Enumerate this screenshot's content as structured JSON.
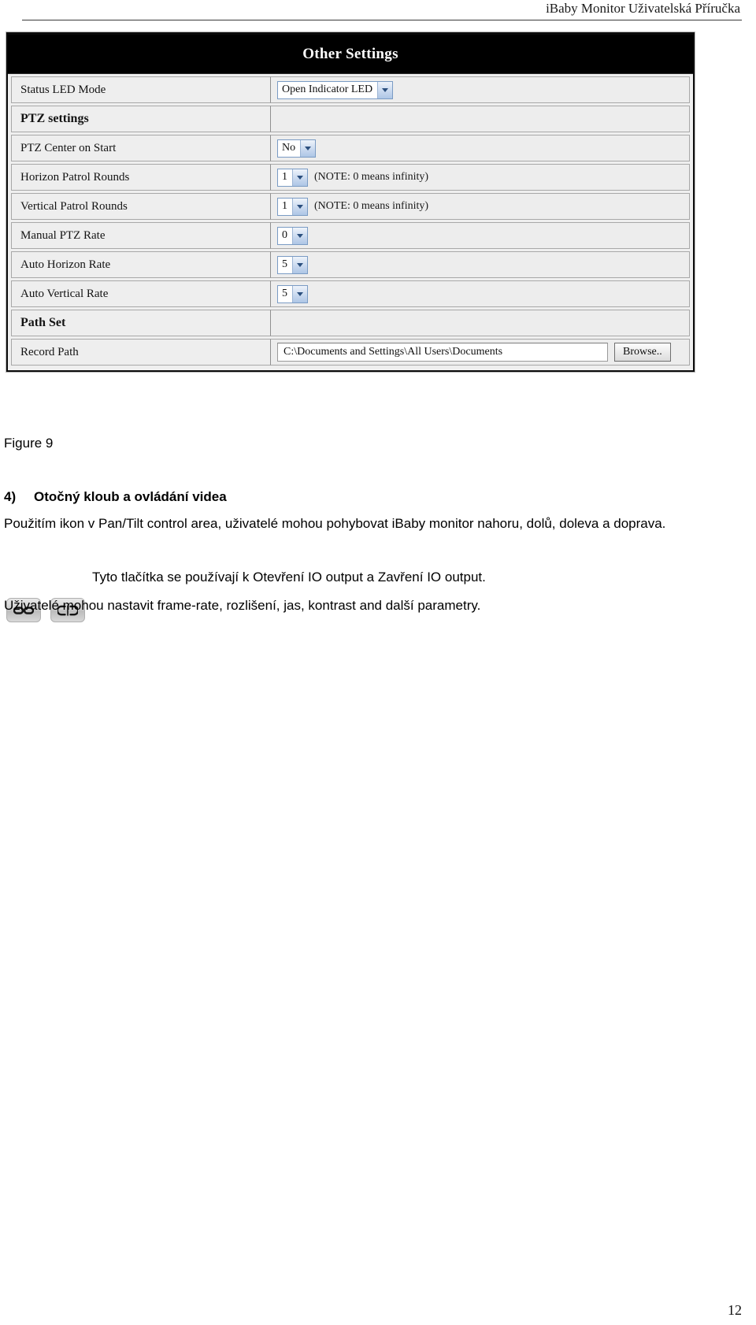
{
  "header": {
    "title": "iBaby Monitor Uživatelská Příručka"
  },
  "figure": {
    "panel_title": "Other Settings",
    "caption": "Figure 9",
    "rows": [
      {
        "label": "Status LED Mode",
        "control": "select",
        "value": "Open Indicator LED",
        "note": "",
        "section": false
      },
      {
        "label": "PTZ settings",
        "control": "none",
        "value": "",
        "note": "",
        "section": true
      },
      {
        "label": "PTZ Center on Start",
        "control": "select",
        "value": "No",
        "note": "",
        "section": false
      },
      {
        "label": "Horizon Patrol Rounds",
        "control": "select",
        "value": "1",
        "note": "(NOTE: 0 means infinity)",
        "section": false
      },
      {
        "label": "Vertical Patrol Rounds",
        "control": "select",
        "value": "1",
        "note": "(NOTE: 0 means infinity)",
        "section": false
      },
      {
        "label": "Manual PTZ Rate",
        "control": "select",
        "value": "0",
        "note": "",
        "section": false
      },
      {
        "label": "Auto Horizon Rate",
        "control": "select",
        "value": "5",
        "note": "",
        "section": false
      },
      {
        "label": "Auto Vertical Rate",
        "control": "select",
        "value": "5",
        "note": "",
        "section": false
      },
      {
        "label": "Path Set",
        "control": "none",
        "value": "",
        "note": "",
        "section": true
      },
      {
        "label": "Record Path",
        "control": "path",
        "value": "C:\\Documents and Settings\\All Users\\Documents",
        "button_label": "Browse..",
        "note": "",
        "section": false
      }
    ]
  },
  "content": {
    "section_number": "4)",
    "section_title": "Otočný kloub a ovládání videa",
    "intro_paragraph": "Použitím ikon v Pan/Tilt control area, uživatelé mohou pohybovat iBaby monitor nahoru, dolů, doleva a doprava.",
    "icons": [
      {
        "name": "link-icon",
        "glyph": "⚭"
      },
      {
        "name": "broken-link-icon",
        "glyph": "⚮"
      }
    ],
    "icons_paragraph": "Tyto tlačítka se používají k Otevření IO output a Zavření IO output.",
    "tail_paragraph": "Uživatelé mohou nastavit frame-rate, rozlišení, jas, kontrast and další parametry."
  },
  "footer": {
    "page_number": "12"
  }
}
